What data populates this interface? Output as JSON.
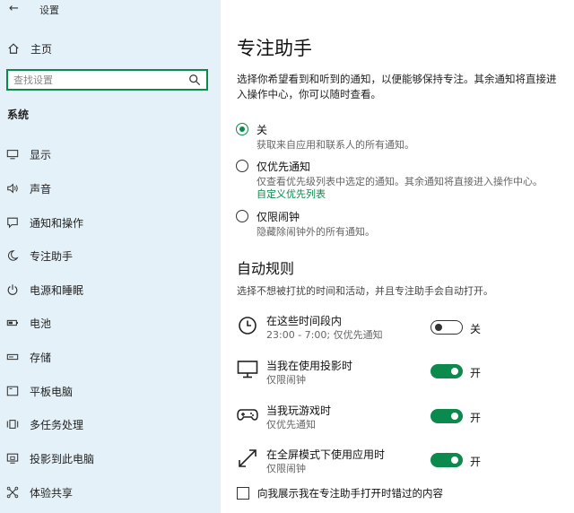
{
  "window": {
    "title": "设置",
    "back_icon": "back-arrow-icon"
  },
  "sidebar": {
    "home_label": "主页",
    "search_placeholder": "查找设置",
    "section_title": "系统",
    "items": [
      {
        "label": "显示",
        "icon": "monitor-icon"
      },
      {
        "label": "声音",
        "icon": "speaker-icon"
      },
      {
        "label": "通知和操作",
        "icon": "notification-icon"
      },
      {
        "label": "专注助手",
        "icon": "moon-icon"
      },
      {
        "label": "电源和睡眠",
        "icon": "power-icon"
      },
      {
        "label": "电池",
        "icon": "battery-icon"
      },
      {
        "label": "存储",
        "icon": "storage-icon"
      },
      {
        "label": "平板电脑",
        "icon": "tablet-icon"
      },
      {
        "label": "多任务处理",
        "icon": "multitask-icon"
      },
      {
        "label": "投影到此电脑",
        "icon": "project-icon"
      },
      {
        "label": "体验共享",
        "icon": "share-icon"
      }
    ]
  },
  "main": {
    "title": "专注助手",
    "description": "选择你希望看到和听到的通知，以便能够保持专注。其余通知将直接进入操作中心，你可以随时查看。",
    "options": [
      {
        "label": "关",
        "sub": "获取来自应用和联系人的所有通知。",
        "selected": true
      },
      {
        "label": "仅优先通知",
        "sub": "仅查看优先级列表中选定的通知。其余通知将直接进入操作中心。",
        "link": "自定义优先列表",
        "selected": false
      },
      {
        "label": "仅限闹钟",
        "sub": "隐藏除闹钟外的所有通知。",
        "selected": false
      }
    ],
    "auto_rules": {
      "title": "自动规则",
      "description": "选择不想被打扰的时间和活动，并且专注助手会自动打开。",
      "rules": [
        {
          "title": "在这些时间段内",
          "sub": "23:00 - 7:00; 仅优先通知",
          "icon": "clock-icon",
          "state": "关",
          "on": false
        },
        {
          "title": "当我在使用投影时",
          "sub": "仅限闹钟",
          "icon": "display-icon",
          "state": "开",
          "on": true
        },
        {
          "title": "当我玩游戏时",
          "sub": "仅优先通知",
          "icon": "gamepad-icon",
          "state": "开",
          "on": true
        },
        {
          "title": "在全屏模式下使用应用时",
          "sub": "仅限闹钟",
          "icon": "fullscreen-icon",
          "state": "开",
          "on": true
        }
      ]
    },
    "summary_checkbox": {
      "label": "向我展示我在专注助手打开时错过的内容",
      "checked": false
    }
  },
  "colors": {
    "accent": "#0b8a4e",
    "sidebar_bg": "#e4f1f8",
    "link": "#0b8a4e"
  }
}
